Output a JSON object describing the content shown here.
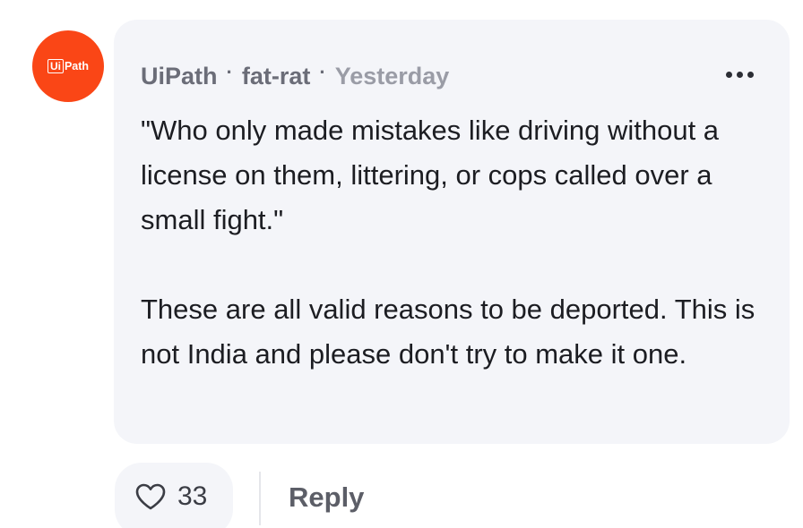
{
  "comment": {
    "avatar_logo": {
      "box_text": "Ui",
      "rest_text": "Path"
    },
    "author": "UiPath",
    "separator": "·",
    "username": "fat-rat",
    "timestamp": "Yesterday",
    "body_paragraphs": [
      "\"Who only made mistakes like driving without a license on them, littering, or cops called over a small fight.\"",
      "These are all valid reasons to be deported. This is not India and please don't try to make it one."
    ]
  },
  "actions": {
    "like_count": "33",
    "like_icon": "heart-outline-icon",
    "reply_label": "Reply",
    "more_icon": "more-horizontal-icon"
  },
  "colors": {
    "avatar_bg": "#fa4616",
    "bubble_bg": "#f4f5f9",
    "text": "#1c1d22",
    "meta_text": "#6b6d78",
    "timestamp_text": "#9a9ca6"
  }
}
